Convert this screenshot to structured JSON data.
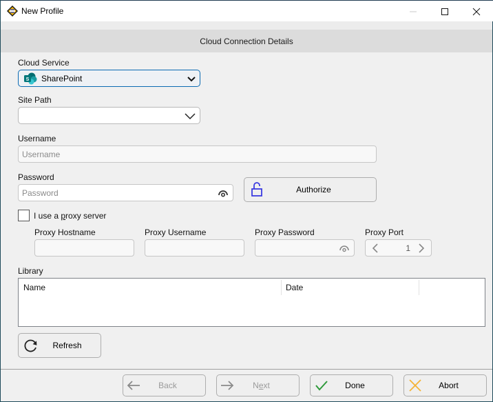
{
  "window": {
    "title": "New Profile",
    "controls": {
      "minimize": "minimize",
      "maximize": "maximize",
      "close": "close"
    }
  },
  "section": {
    "title": "Cloud Connection Details"
  },
  "form": {
    "cloud_service": {
      "label": "Cloud Service",
      "value": "SharePoint",
      "icon": "sharepoint-icon"
    },
    "site_path": {
      "label": "Site Path",
      "value": ""
    },
    "username": {
      "label": "Username",
      "value": "",
      "placeholder": "Username"
    },
    "password": {
      "label": "Password",
      "value": "",
      "placeholder": "Password",
      "icon": "eye-icon"
    },
    "authorize_button": {
      "label": "Authorize",
      "icon": "unlock-icon"
    },
    "proxy_checkbox": {
      "label_pre": "I use a ",
      "label_mnemonic": "p",
      "label_post": "roxy server",
      "checked": false
    },
    "proxy_hostname": {
      "label": "Proxy Hostname",
      "value": ""
    },
    "proxy_username": {
      "label": "Proxy Username",
      "value": ""
    },
    "proxy_password": {
      "label": "Proxy Password",
      "value": ""
    },
    "proxy_port": {
      "label": "Proxy Port",
      "value": "1"
    }
  },
  "library": {
    "label": "Library",
    "columns": [
      "Name",
      "Date",
      ""
    ],
    "rows": []
  },
  "refresh_button": {
    "label": "Refresh",
    "icon": "refresh-icon"
  },
  "footer": {
    "back": {
      "label": "Back",
      "enabled": false
    },
    "next": {
      "label_pre": "N",
      "label_mnemonic": "e",
      "label_post": "xt",
      "enabled": false
    },
    "done": {
      "label": "Done",
      "enabled": true
    },
    "abort": {
      "label": "Abort",
      "enabled": true
    }
  },
  "colors": {
    "accent_blue": "#0a6ab2",
    "authorize_icon": "#3b3be0",
    "done_check": "#2e9a3a",
    "abort_x": "#f5b335"
  }
}
